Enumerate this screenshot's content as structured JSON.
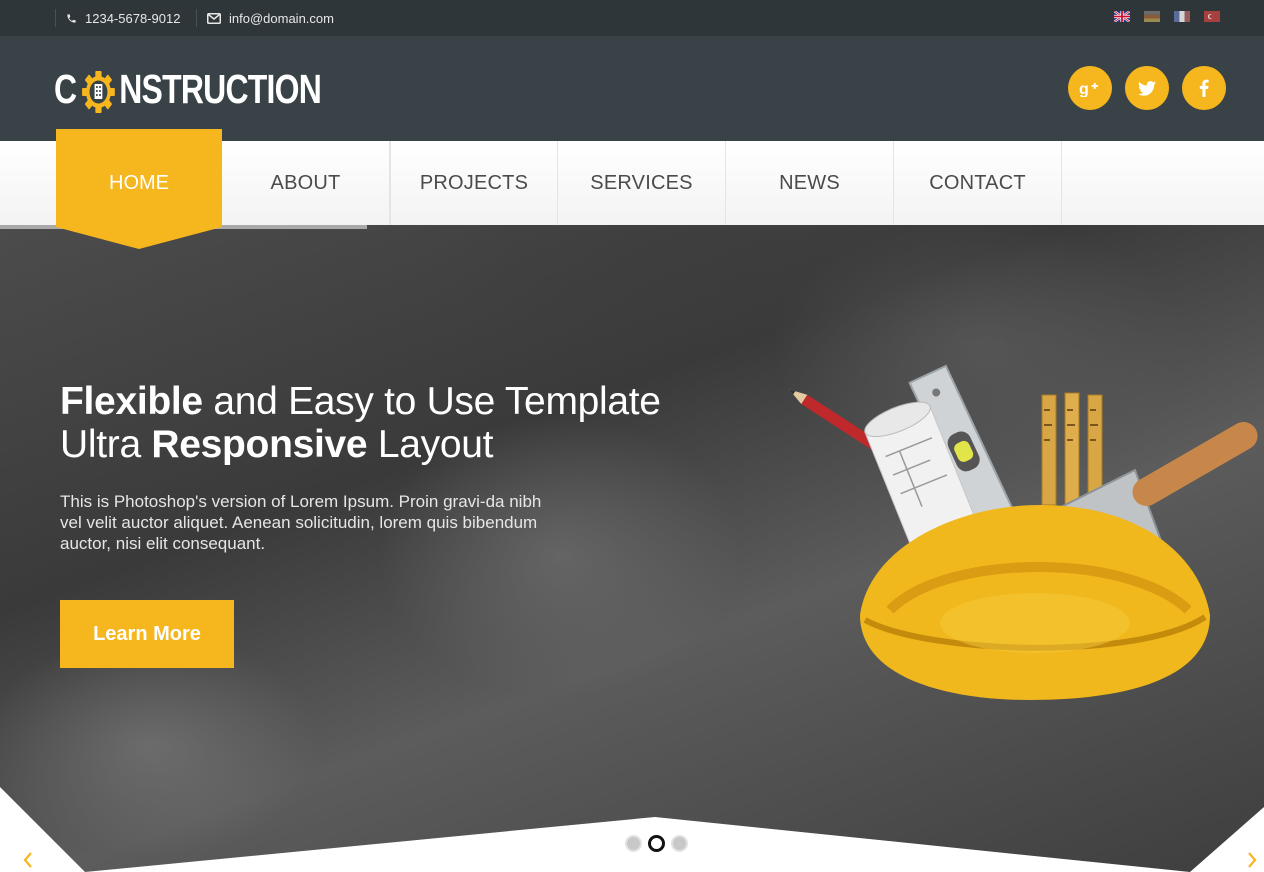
{
  "topbar": {
    "phone": "1234-5678-9012",
    "email": "info@domain.com",
    "phone_icon": "phone-icon",
    "email_icon": "envelope-icon",
    "flags": [
      "flag-uk",
      "flag-germany",
      "flag-france",
      "flag-turkey"
    ]
  },
  "header": {
    "logo_prefix": "C",
    "logo_suffix": "NSTRUCTION",
    "logo_icon": "gear-building-icon",
    "social": [
      "google-plus-icon",
      "twitter-icon",
      "facebook-icon"
    ]
  },
  "nav": {
    "items": [
      {
        "label": "HOME",
        "active": true
      },
      {
        "label": "ABOUT"
      },
      {
        "label": "PROJECTS"
      },
      {
        "label": "SERVICES"
      },
      {
        "label": "NEWS"
      },
      {
        "label": "CONTACT"
      }
    ]
  },
  "hero": {
    "headline_line1_bold": "Flexible",
    "headline_line1_rest": " and Easy to Use Template",
    "headline_line2_start": "Ultra ",
    "headline_line2_bold": "Responsive",
    "headline_line2_end": " Layout",
    "paragraph": "This is Photoshop's version of Lorem Ipsum. Proin gravi-da nibh vel velit auctor aliquet. Aenean solicitudin, lorem quis bibendum auctor, nisi elit consequant.",
    "button": "Learn More",
    "slider_dots": 3,
    "active_dot": 2,
    "prev_icon": "chevron-left-icon",
    "next_icon": "chevron-right-icon"
  },
  "colors": {
    "accent": "#f6b61e",
    "topbar": "#2f3639",
    "header": "#394246"
  }
}
